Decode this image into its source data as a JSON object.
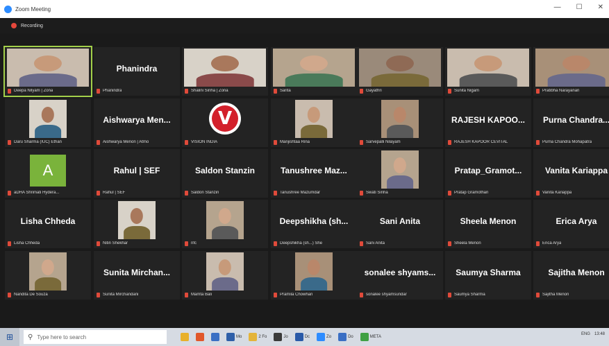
{
  "window": {
    "title": "Zoom Meeting",
    "minimize": "—",
    "maximize": "☐",
    "close": "✕"
  },
  "recording": {
    "label": "Recording",
    "color": "#e5473b"
  },
  "participants": [
    {
      "name": "Deepa Nilyam | Zona",
      "display": "video",
      "active": true
    },
    {
      "name": "Phanindra",
      "display": "name",
      "big": "Phanindra"
    },
    {
      "name": "Shalini Sinha | Zona",
      "display": "video"
    },
    {
      "name": "Sarita",
      "display": "video"
    },
    {
      "name": "Gayathri",
      "display": "video"
    },
    {
      "name": "Sunita Nigam",
      "display": "video"
    },
    {
      "name": "Pratibha Narayanan",
      "display": "video"
    },
    {
      "name": "Daru Sharma (IUC) Ethan",
      "display": "video"
    },
    {
      "name": "Aishwarya Menon | Atmo",
      "display": "name",
      "big": "Aishwarya Men..."
    },
    {
      "name": "VISION INDIA",
      "display": "logo-v"
    },
    {
      "name": "Manjishtaa Rina",
      "display": "video"
    },
    {
      "name": "Sarvepalli Nilayam",
      "display": "video"
    },
    {
      "name": "RAJESH KAPOOR CEVITAL",
      "display": "name",
      "big": "RAJESH KAPOO..."
    },
    {
      "name": "Purna Chandra Mohapatra",
      "display": "name",
      "big": "Purna Chandra..."
    },
    {
      "name": "aDHA Shrimati Hydera...",
      "display": "avatar",
      "letter": "A"
    },
    {
      "name": "Rahul | SEF",
      "display": "name",
      "big": "Rahul | SEF"
    },
    {
      "name": "Saldon Stanzin",
      "display": "name",
      "big": "Saldon Stanzin"
    },
    {
      "name": "Tanushree Mazumdar",
      "display": "name",
      "big": "Tanushree Maz..."
    },
    {
      "name": "Swati Sinha",
      "display": "video"
    },
    {
      "name": "Pratap Gramothan",
      "display": "name",
      "big": "Pratap_Gramot..."
    },
    {
      "name": "Vanita Kariappa",
      "display": "name",
      "big": "Vanita Kariappa"
    },
    {
      "name": "Lisha Chheda",
      "display": "name",
      "big": "Lisha Chheda"
    },
    {
      "name": "Nitin Shekhar",
      "display": "video"
    },
    {
      "name": "nfc",
      "display": "video"
    },
    {
      "name": "Deepshikha (sh...) She",
      "display": "name",
      "big": "Deepshikha (sh..."
    },
    {
      "name": "Sani Anita",
      "display": "name",
      "big": "Sani Anita"
    },
    {
      "name": "Sheela Menon",
      "display": "name",
      "big": "Sheela Menon"
    },
    {
      "name": "Erica Arya",
      "display": "name",
      "big": "Erica Arya"
    },
    {
      "name": "Nandita De Souza",
      "display": "video"
    },
    {
      "name": "Sunita Mirchandani",
      "display": "name",
      "big": "Sunita Mirchan..."
    },
    {
      "name": "Mamta Bali",
      "display": "video"
    },
    {
      "name": "Pramila Chowhan",
      "display": "video"
    },
    {
      "name": "sonalee shyamsundar",
      "display": "name",
      "big": "sonalee shyams..."
    },
    {
      "name": "Saumya Sharma",
      "display": "name",
      "big": "Saumya Sharma"
    },
    {
      "name": "Sajitha Menon",
      "display": "name",
      "big": "Sajitha Menon"
    }
  ],
  "taskbar": {
    "search_placeholder": "Type here to search",
    "apps": [
      {
        "label": "",
        "color": "#e8b02a"
      },
      {
        "label": "",
        "color": "#e1572a"
      },
      {
        "label": "",
        "color": "#3a6fc4"
      },
      {
        "label": "Mo",
        "color": "#2f5fa8"
      },
      {
        "label": "2 Fo",
        "color": "#e4b43a"
      },
      {
        "label": "Jo",
        "color": "#3a3a3a"
      },
      {
        "label": "Dc",
        "color": "#2a5aa8"
      },
      {
        "label": "Zo",
        "color": "#2d8cff"
      },
      {
        "label": "Do",
        "color": "#3a6fc4"
      },
      {
        "label": "META",
        "color": "#3fa043"
      }
    ],
    "tray_lang": "ENG",
    "time": "13:48"
  }
}
